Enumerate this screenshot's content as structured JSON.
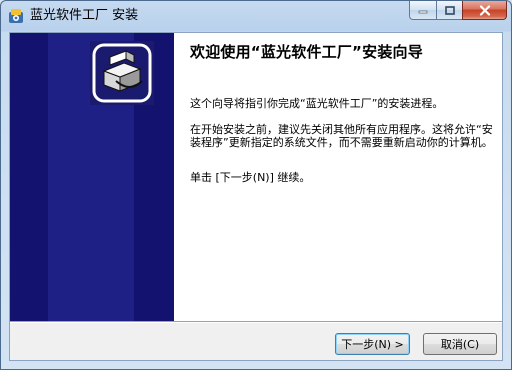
{
  "window": {
    "title": "蓝光软件工厂 安装",
    "icon": "installer-icon",
    "controls": [
      "minimize-icon",
      "maximize-icon",
      "close-icon"
    ]
  },
  "banner": {
    "color": "#13126f",
    "icon": "installer-box-icon"
  },
  "content": {
    "heading": "欢迎使用“蓝光软件工厂”安装向导",
    "paragraph1": "这个向导将指引你完成“蓝光软件工厂”的安装进程。",
    "paragraph2": "在开始安装之前，建议先关闭其他所有应用程序。这将允许“安装程序”更新指定的系统文件，而不需要重新启动你的计算机。",
    "paragraph3": "单击 [下一步(N)] 继续。"
  },
  "buttons": {
    "next_label": "下一步(N) >",
    "cancel_label": "取消(C)"
  }
}
